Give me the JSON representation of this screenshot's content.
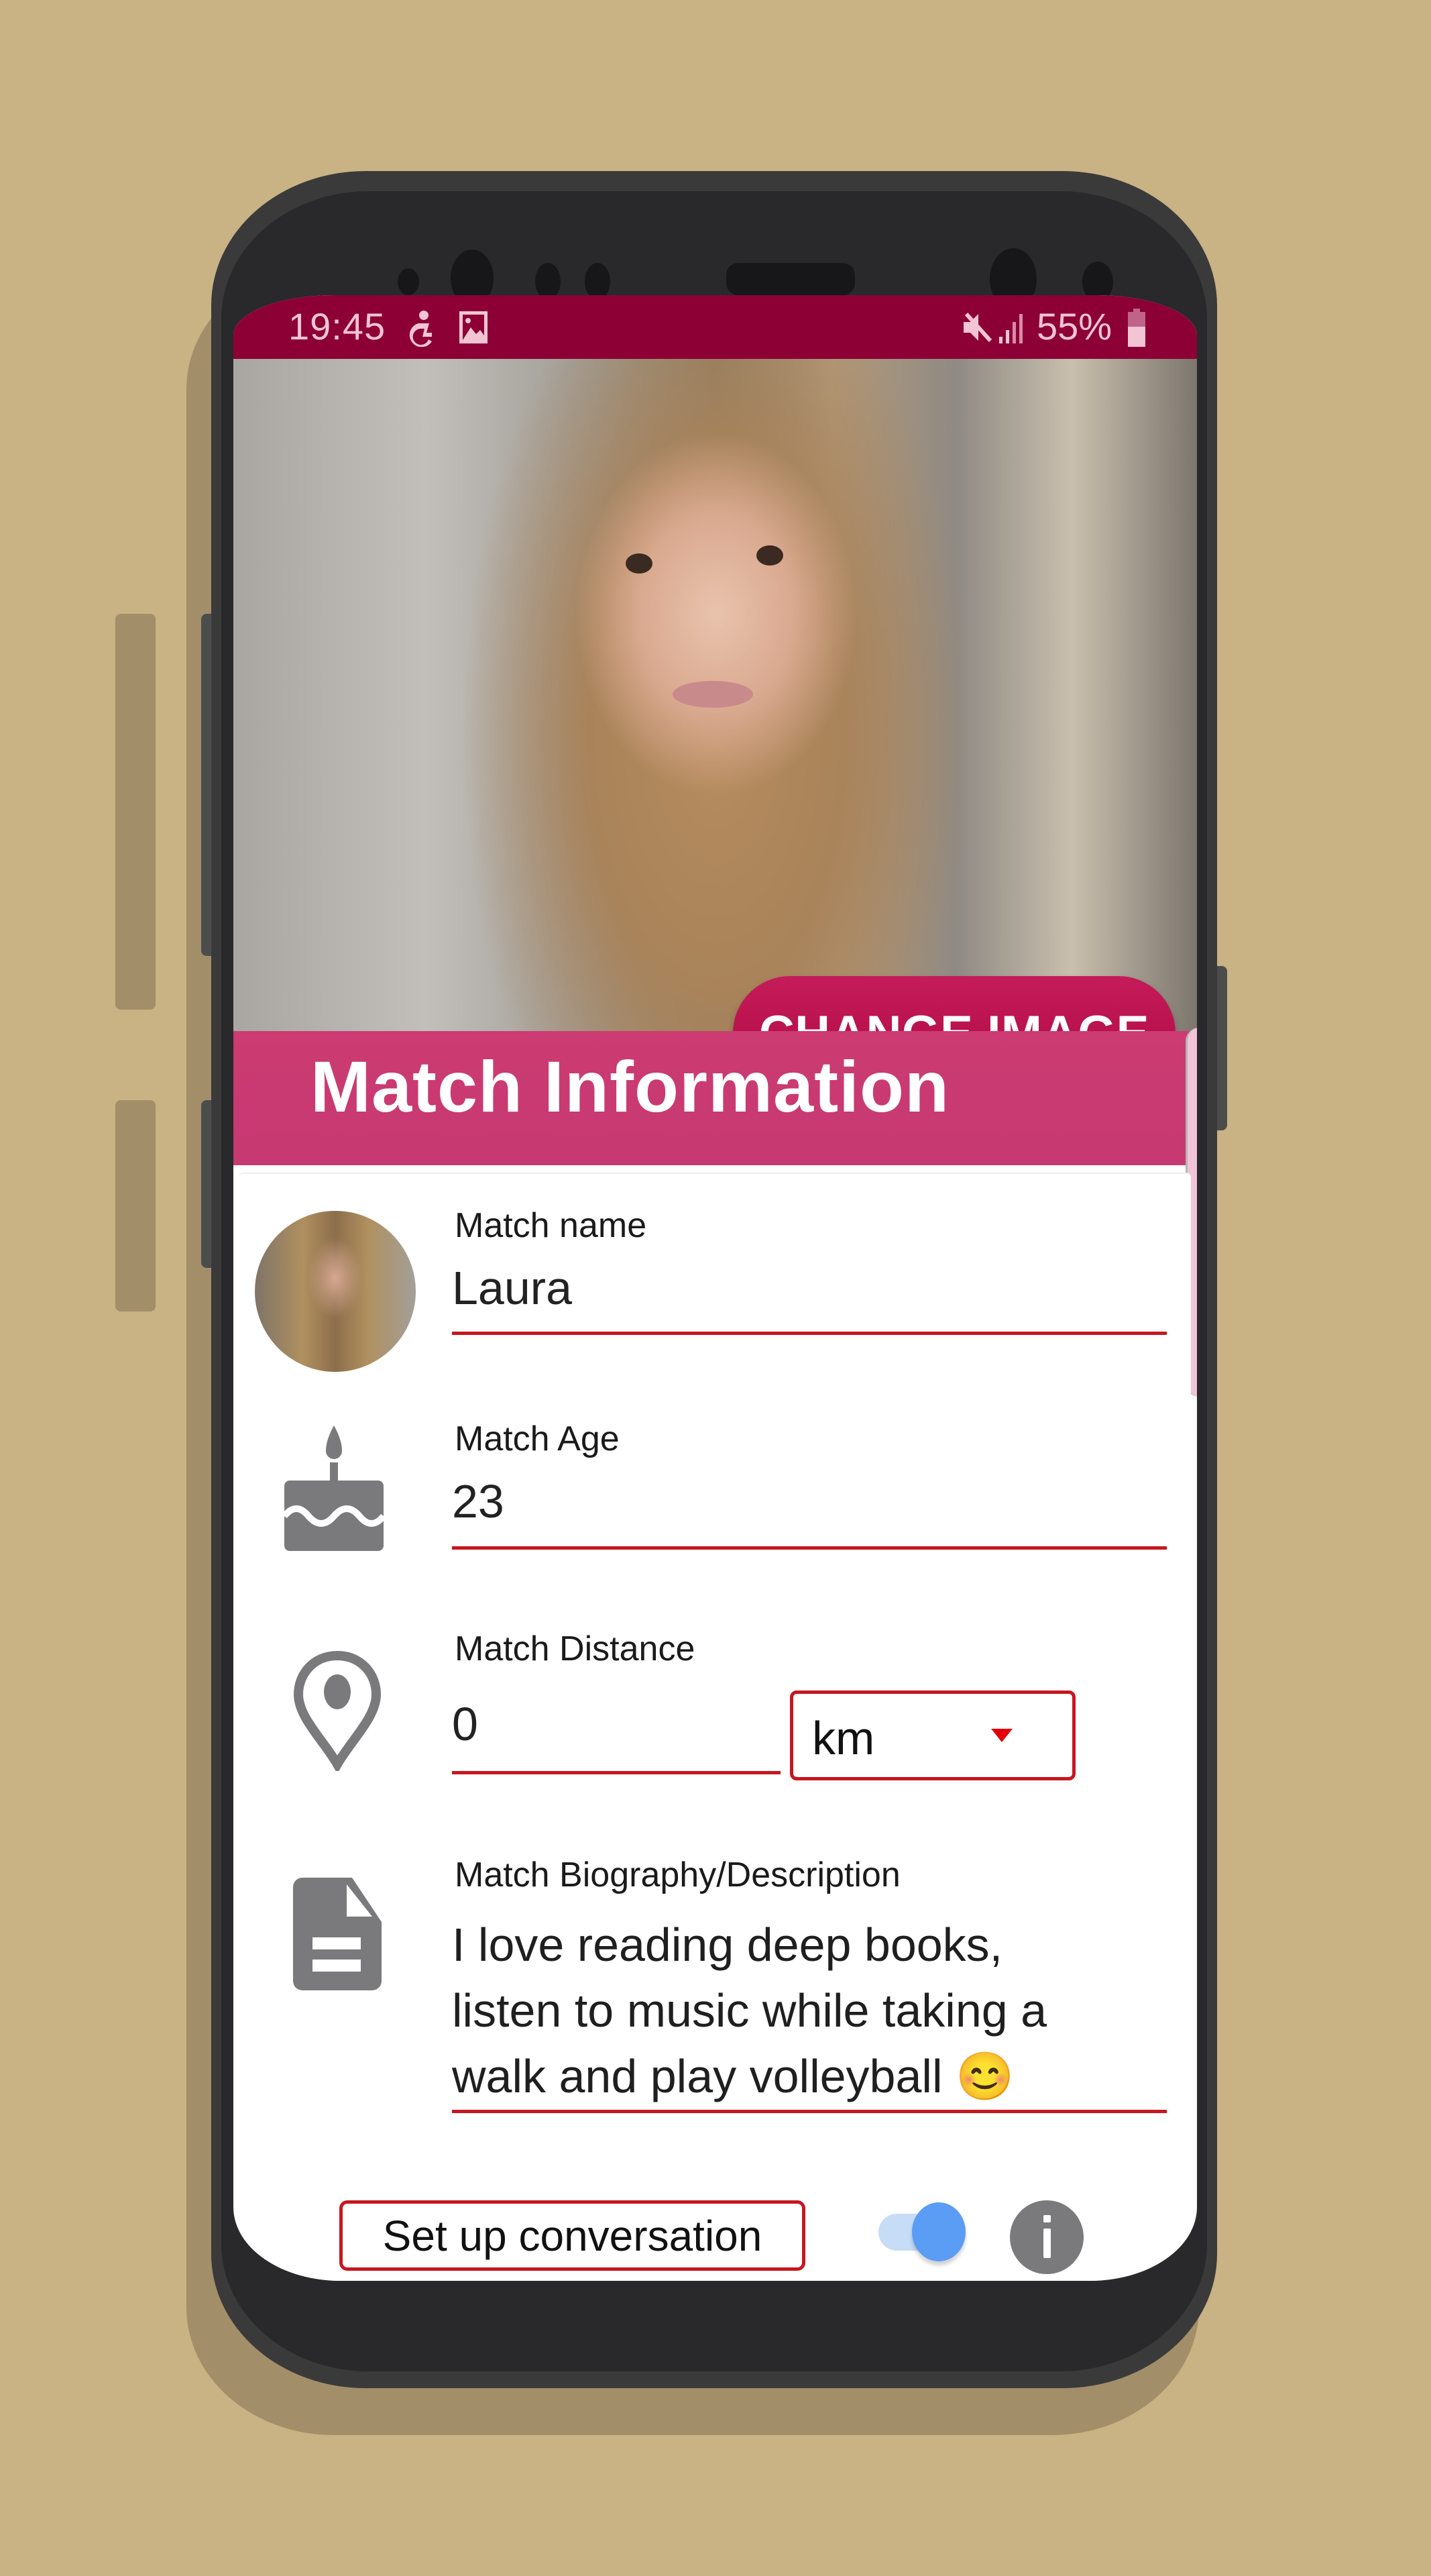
{
  "status_bar": {
    "time": "19:45",
    "left_icons": [
      "accessibility-icon",
      "image-notification-icon"
    ],
    "right_icons": [
      "mute-icon",
      "signal-icon",
      "battery-icon"
    ],
    "battery_percent": "55%"
  },
  "hero": {
    "change_image_label": "CHANGE IMAGE"
  },
  "header": {
    "title": "Match Information"
  },
  "form": {
    "name": {
      "label": "Match name",
      "value": "Laura"
    },
    "age": {
      "label": "Match Age",
      "value": "23"
    },
    "distance": {
      "label": "Match Distance",
      "value": "0",
      "unit_selected": "km"
    },
    "bio": {
      "label": "Match Biography/Description",
      "lines": [
        "I love reading deep books,",
        "listen to music while taking a",
        "walk and play volleyball 😊"
      ]
    }
  },
  "actions": {
    "setup_conversation_label": "Set up conversation",
    "toggle_on": true
  },
  "colors": {
    "status_bar": "#8c0035",
    "accent": "#c8161f",
    "header_band": "#cc3b72",
    "button": "#b8114c",
    "toggle": "#5b9df4",
    "background": "#c9b283"
  }
}
